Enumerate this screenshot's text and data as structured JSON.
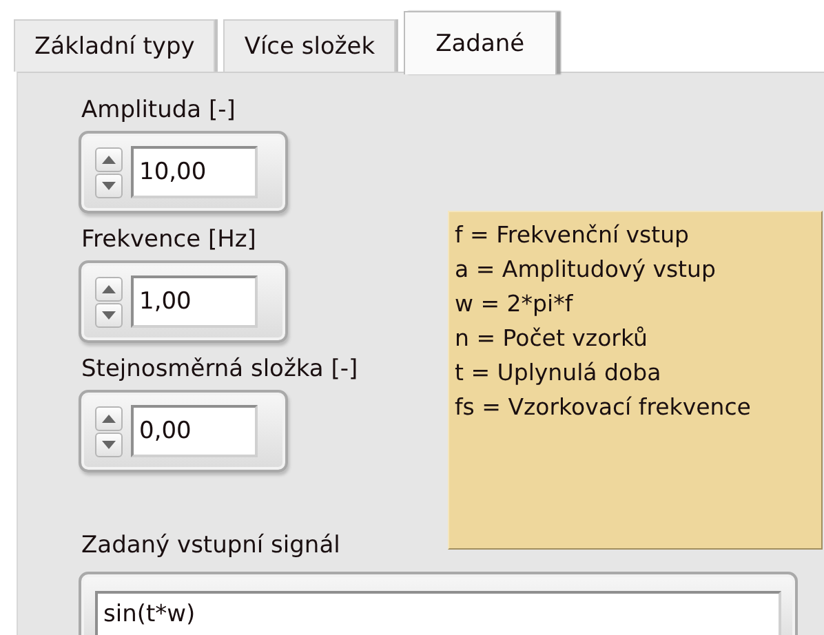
{
  "tabs": [
    {
      "label": "Základní typy",
      "selected": false
    },
    {
      "label": "Více složek",
      "selected": false
    },
    {
      "label": "Zadané",
      "selected": true
    }
  ],
  "controls": [
    {
      "label": "Amplituda [-]",
      "value": "10,00"
    },
    {
      "label": "Frekvence [Hz]",
      "value": "1,00"
    },
    {
      "label": "Stejnosměrná složka [-]",
      "value": "0,00"
    }
  ],
  "note": {
    "lines": [
      "f = Frekvenční vstup",
      "a = Amplitudový vstup",
      "w = 2*pi*f",
      "n = Počet vzorků",
      "t = Uplynulá doba",
      "fs = Vzorkovací frekvence"
    ]
  },
  "signal": {
    "label": "Zadaný vstupní signál",
    "value": "sin(t*w)"
  }
}
